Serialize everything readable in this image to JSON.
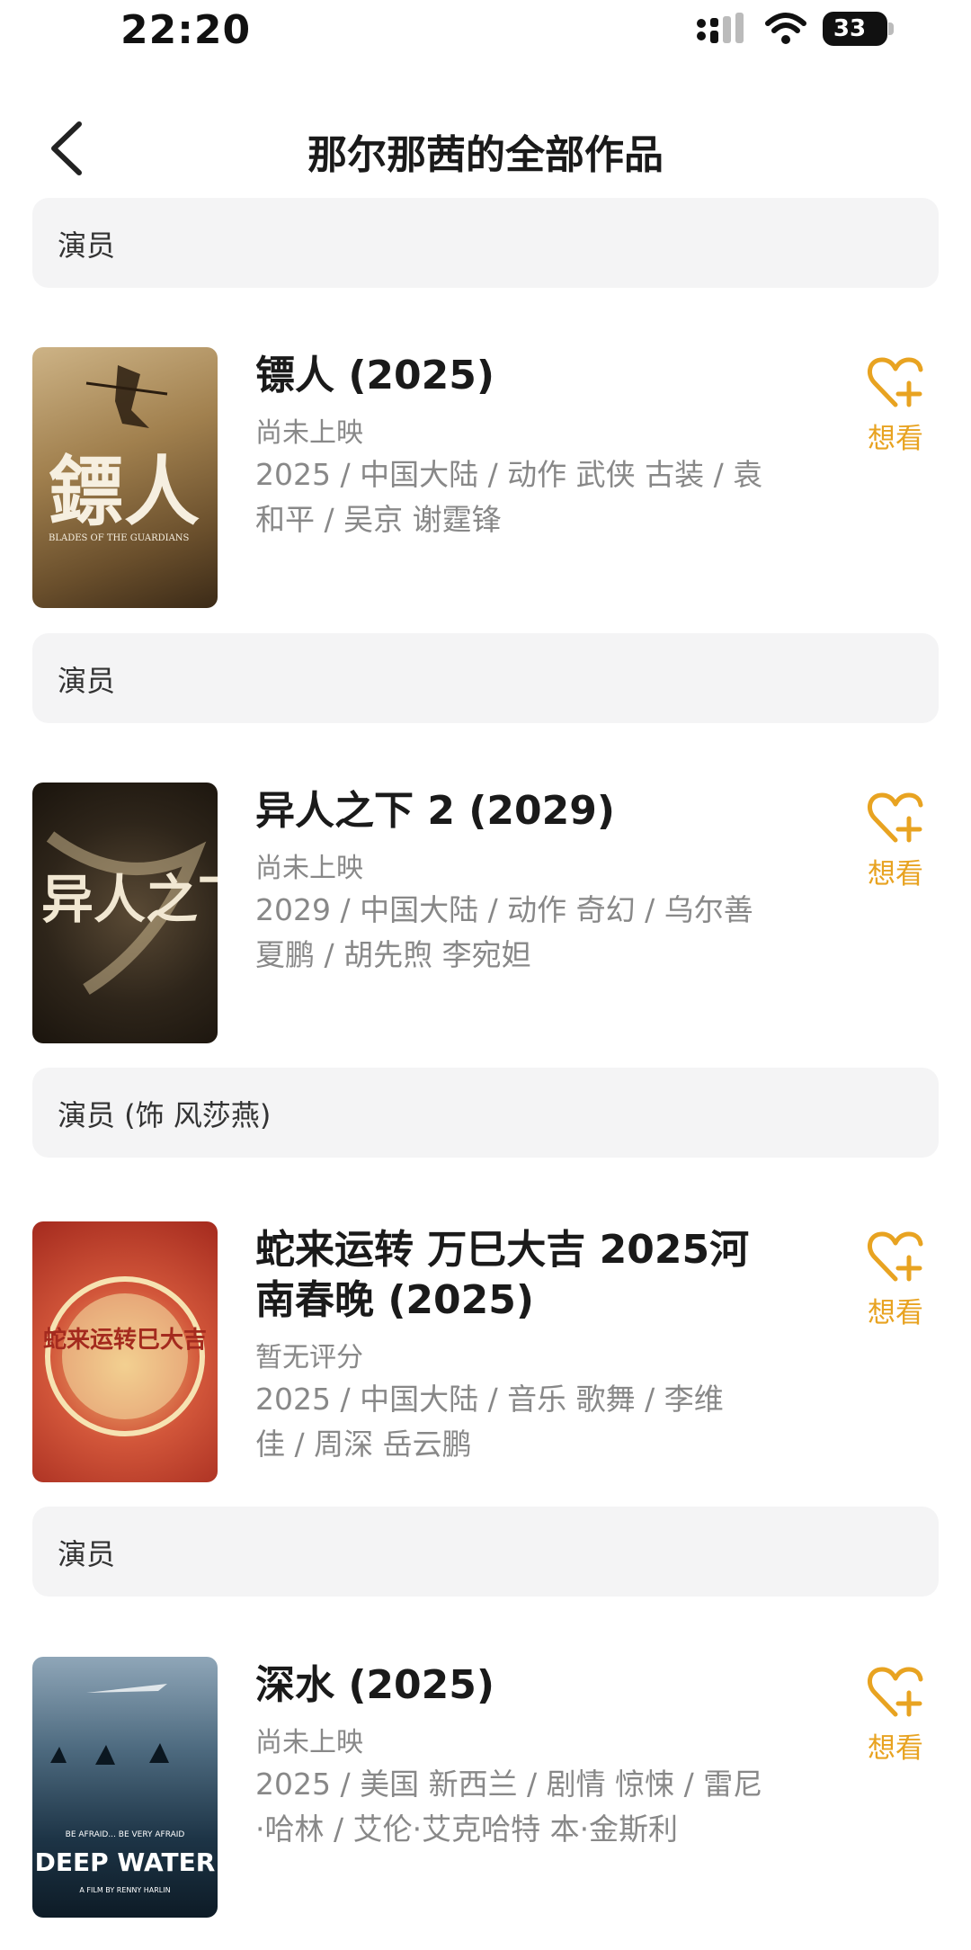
{
  "status_bar": {
    "time": "22:20",
    "battery": "33"
  },
  "header": {
    "title": "那尔那茜的全部作品"
  },
  "colors": {
    "accent": "#e8a321",
    "role_bg": "#f4f4f5",
    "muted_text": "#888888"
  },
  "want_label": "想看",
  "sections": [
    {
      "role": "演员",
      "movie": {
        "title": "镖人 (2025)",
        "status": "尚未上映",
        "meta_line1": "2025 / 中国大陆 / 动作 武侠 古装 / 袁",
        "meta_line2": "和平 / 吴京 谢霆锋",
        "poster_art": "鏢人",
        "poster_sub": "BLADES OF THE GUARDIANS"
      }
    },
    {
      "role": "演员",
      "movie": {
        "title": "异人之下 2 (2029)",
        "status": "尚未上映",
        "meta_line1": "2029 / 中国大陆 / 动作 奇幻 / 乌尔善",
        "meta_line2": "夏鹏 / 胡先煦 李宛妲",
        "poster_art": "异人之下"
      }
    },
    {
      "role": "演员 (饰 风莎燕)",
      "movie": {
        "title_line1": "蛇来运转 万巳大吉 2025河",
        "title_line2": "南春晚 (2025)",
        "status": "暂无评分",
        "meta_line1": "2025 / 中国大陆 / 音乐 歌舞 / 李维",
        "meta_line2": "佳 / 周深 岳云鹏",
        "poster_art": "蛇来运转巳大吉"
      }
    },
    {
      "role": "演员",
      "movie": {
        "title": "深水 (2025)",
        "status": "尚未上映",
        "meta_line1": "2025 / 美国 新西兰 / 剧情 惊悚 / 雷尼",
        "meta_line2": "·哈林 / 艾伦·艾克哈特 本·金斯利",
        "poster_art": "DEEP WATER",
        "poster_tagline": "BE AFRAID... BE VERY AFRAID",
        "poster_credit": "A FILM BY RENNY HARLIN"
      }
    }
  ]
}
